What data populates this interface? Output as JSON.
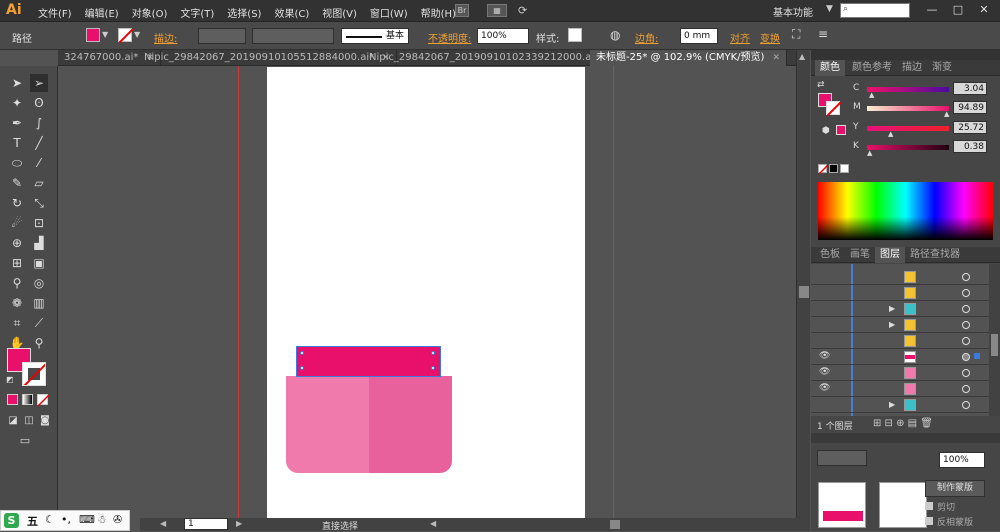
{
  "app": {
    "logo": "Ai",
    "menu": [
      "文件(F)",
      "编辑(E)",
      "对象(O)",
      "文字(T)",
      "选择(S)",
      "效果(C)",
      "视图(V)",
      "窗口(W)",
      "帮助(H)"
    ],
    "bridge_label": "Br",
    "workspace": "基本功能",
    "window_buttons": [
      "—",
      "□",
      "✕"
    ]
  },
  "control_bar": {
    "selection_type": "路径",
    "stroke_label": "描边:",
    "stroke_profile": "基本",
    "opacity_label": "不透明度:",
    "opacity_value": "100%",
    "style_label": "样式:",
    "corner_label": "边角:",
    "corner_value": "0 mm",
    "align_label": "对齐",
    "transform_label": "变换",
    "fill_color": "#e8106a"
  },
  "tabs": [
    {
      "label": "324767000.ai*",
      "active": false
    },
    {
      "label": "Nipic_29842067_20190910105512884000.ai*",
      "active": false
    },
    {
      "label": "Nipic_29842067_20190910102339212000.ai*",
      "active": false
    },
    {
      "label": "未标题-25* @ 102.9% (CMYK/预览)",
      "active": true
    }
  ],
  "tab_close": "✕",
  "color_panel": {
    "tabs": [
      "颜色",
      "颜色参考",
      "描边",
      "渐变"
    ],
    "sliders": [
      {
        "label": "C",
        "value": "3.04",
        "level": 0.03
      },
      {
        "label": "M",
        "value": "94.89",
        "level": 0.95
      },
      {
        "label": "Y",
        "value": "25.72",
        "level": 0.26
      },
      {
        "label": "K",
        "value": "0.38",
        "level": 0.01
      }
    ]
  },
  "layers_panel": {
    "tabs": [
      "色板",
      "画笔",
      "图层",
      "路径查找器"
    ],
    "footer": "1 个图层",
    "rows": [
      {
        "eye": "",
        "expand": "",
        "thumb_color": "#f2c230"
      },
      {
        "eye": "",
        "expand": "",
        "thumb_color": "#f2c230"
      },
      {
        "eye": "",
        "expand": "▶",
        "thumb_color": "#3cc0c8"
      },
      {
        "eye": "",
        "expand": "▶",
        "thumb_color": "#f2c230"
      },
      {
        "eye": "",
        "expand": "",
        "thumb_color": "#f2c230"
      },
      {
        "eye": "👁",
        "expand": "",
        "thumb_color": "#e8106a"
      },
      {
        "eye": "👁",
        "expand": "",
        "thumb_color": "#f07aab"
      },
      {
        "eye": "👁",
        "expand": "",
        "thumb_color": "#f07aab"
      },
      {
        "eye": "",
        "expand": "▶",
        "thumb_color": "#3cc0c8"
      }
    ]
  },
  "transparency_panel": {
    "opacity_value": "100%",
    "make_mask": "制作蒙版",
    "clip": "剪切",
    "invert_mask": "反相蒙版"
  },
  "status_bar": {
    "zoom": "1",
    "tool_name": "直接选择"
  },
  "taskbar": {
    "ime": "五"
  },
  "artwork": {
    "lid_color": "#e8106a",
    "body_left": "#f07aab",
    "body_right": "#e8609c"
  }
}
